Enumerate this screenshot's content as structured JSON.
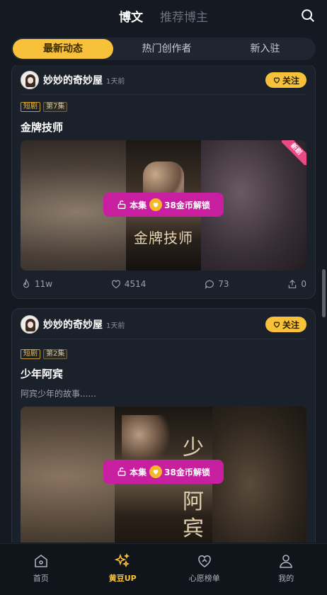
{
  "header": {
    "tab_blog": "博文",
    "tab_recommend": "推荐博主"
  },
  "subtabs": [
    "最新动态",
    "热门创作者",
    "新入驻"
  ],
  "posts": [
    {
      "author": "妙妙的奇妙屋",
      "time": "1天前",
      "follow": "关注",
      "tags": [
        "短剧",
        "第7集"
      ],
      "title": "金牌技师",
      "desc": "",
      "badge": "新剧",
      "poster_text": "金牌技师",
      "unlock_prefix": "本集",
      "unlock_text": "38金币解锁",
      "views": "11w",
      "likes": "4514",
      "comments": "73",
      "shares": "0"
    },
    {
      "author": "妙妙的奇妙屋",
      "time": "1天前",
      "follow": "关注",
      "tags": [
        "短剧",
        "第2集"
      ],
      "title": "少年阿宾",
      "desc": "阿宾少年的故事......",
      "poster_text": "少年阿宾",
      "unlock_prefix": "本集",
      "unlock_text": "38金币解锁"
    }
  ],
  "nav": [
    {
      "label": "首页",
      "icon": "home-icon"
    },
    {
      "label": "黄豆UP",
      "icon": "sparkle-icon"
    },
    {
      "label": "心愿榜单",
      "icon": "heart-icon"
    },
    {
      "label": "我的",
      "icon": "user-icon"
    }
  ],
  "colors": {
    "accent": "#f8c13a",
    "unlock": "#c81fa0",
    "background": "#141922"
  }
}
